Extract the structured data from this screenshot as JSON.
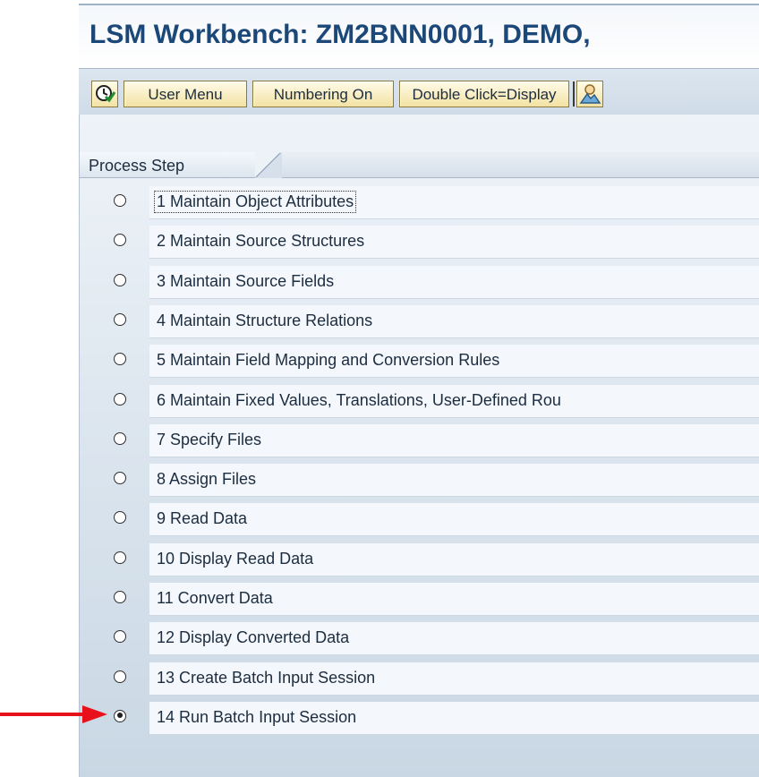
{
  "title": "LSM Workbench: ZM2BNN0001, DEMO,",
  "toolbar": {
    "execute_icon": "execute-clock-icon",
    "user_menu_label": "User Menu",
    "numbering_label": "Numbering On",
    "double_click_label": "Double Click=Display",
    "user_icon": "user-mountain-icon"
  },
  "tab": {
    "label": "Process Step"
  },
  "steps": [
    {
      "label": "1 Maintain Object Attributes",
      "selected": false,
      "focused": true
    },
    {
      "label": "2 Maintain Source Structures",
      "selected": false
    },
    {
      "label": "3 Maintain Source Fields",
      "selected": false
    },
    {
      "label": "4 Maintain Structure Relations",
      "selected": false
    },
    {
      "label": "5 Maintain Field Mapping and Conversion Rules",
      "selected": false
    },
    {
      "label": "6 Maintain Fixed Values, Translations, User-Defined Rou",
      "selected": false
    },
    {
      "label": "7 Specify Files",
      "selected": false
    },
    {
      "label": "8 Assign Files",
      "selected": false
    },
    {
      "label": "9 Read Data",
      "selected": false
    },
    {
      "label": "10 Display Read Data",
      "selected": false
    },
    {
      "label": "11 Convert Data",
      "selected": false
    },
    {
      "label": "12 Display Converted Data",
      "selected": false
    },
    {
      "label": "13 Create Batch Input Session",
      "selected": false
    },
    {
      "label": "14 Run Batch Input Session",
      "selected": true
    }
  ],
  "annotation": {
    "color": "#e8101a"
  }
}
